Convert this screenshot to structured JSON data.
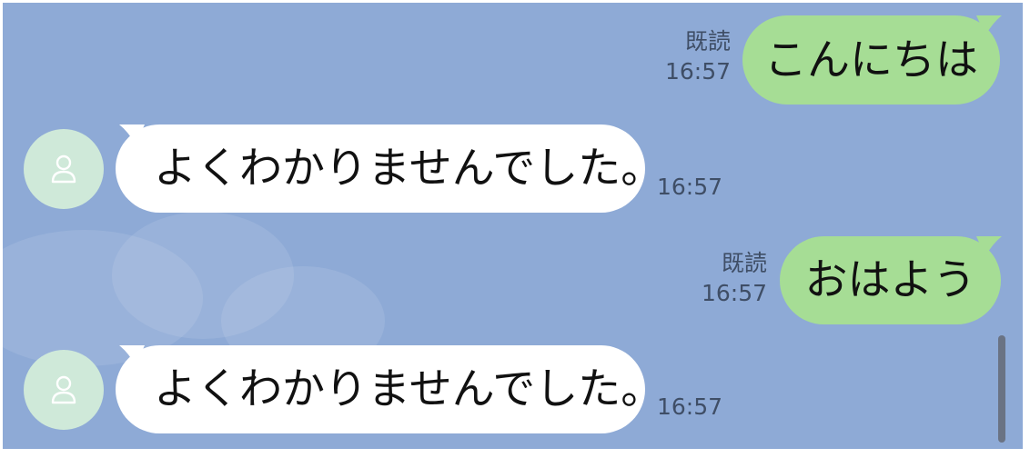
{
  "messages": [
    {
      "side": "sent",
      "text": "こんにちは",
      "read_label": "既読",
      "time": "16:57"
    },
    {
      "side": "received",
      "text": "よくわかりませんでした。",
      "time": "16:57"
    },
    {
      "side": "sent",
      "text": "おはよう",
      "read_label": "既読",
      "time": "16:57"
    },
    {
      "side": "received",
      "text": "よくわかりませんでした。",
      "time": "16:57"
    }
  ],
  "colors": {
    "background": "#8eaad6",
    "sent_bubble": "#a6dd95",
    "received_bubble": "#ffffff",
    "avatar": "#cfe9d9",
    "meta_text": "#3f4e66"
  },
  "icons": {
    "avatar": "person-icon"
  }
}
